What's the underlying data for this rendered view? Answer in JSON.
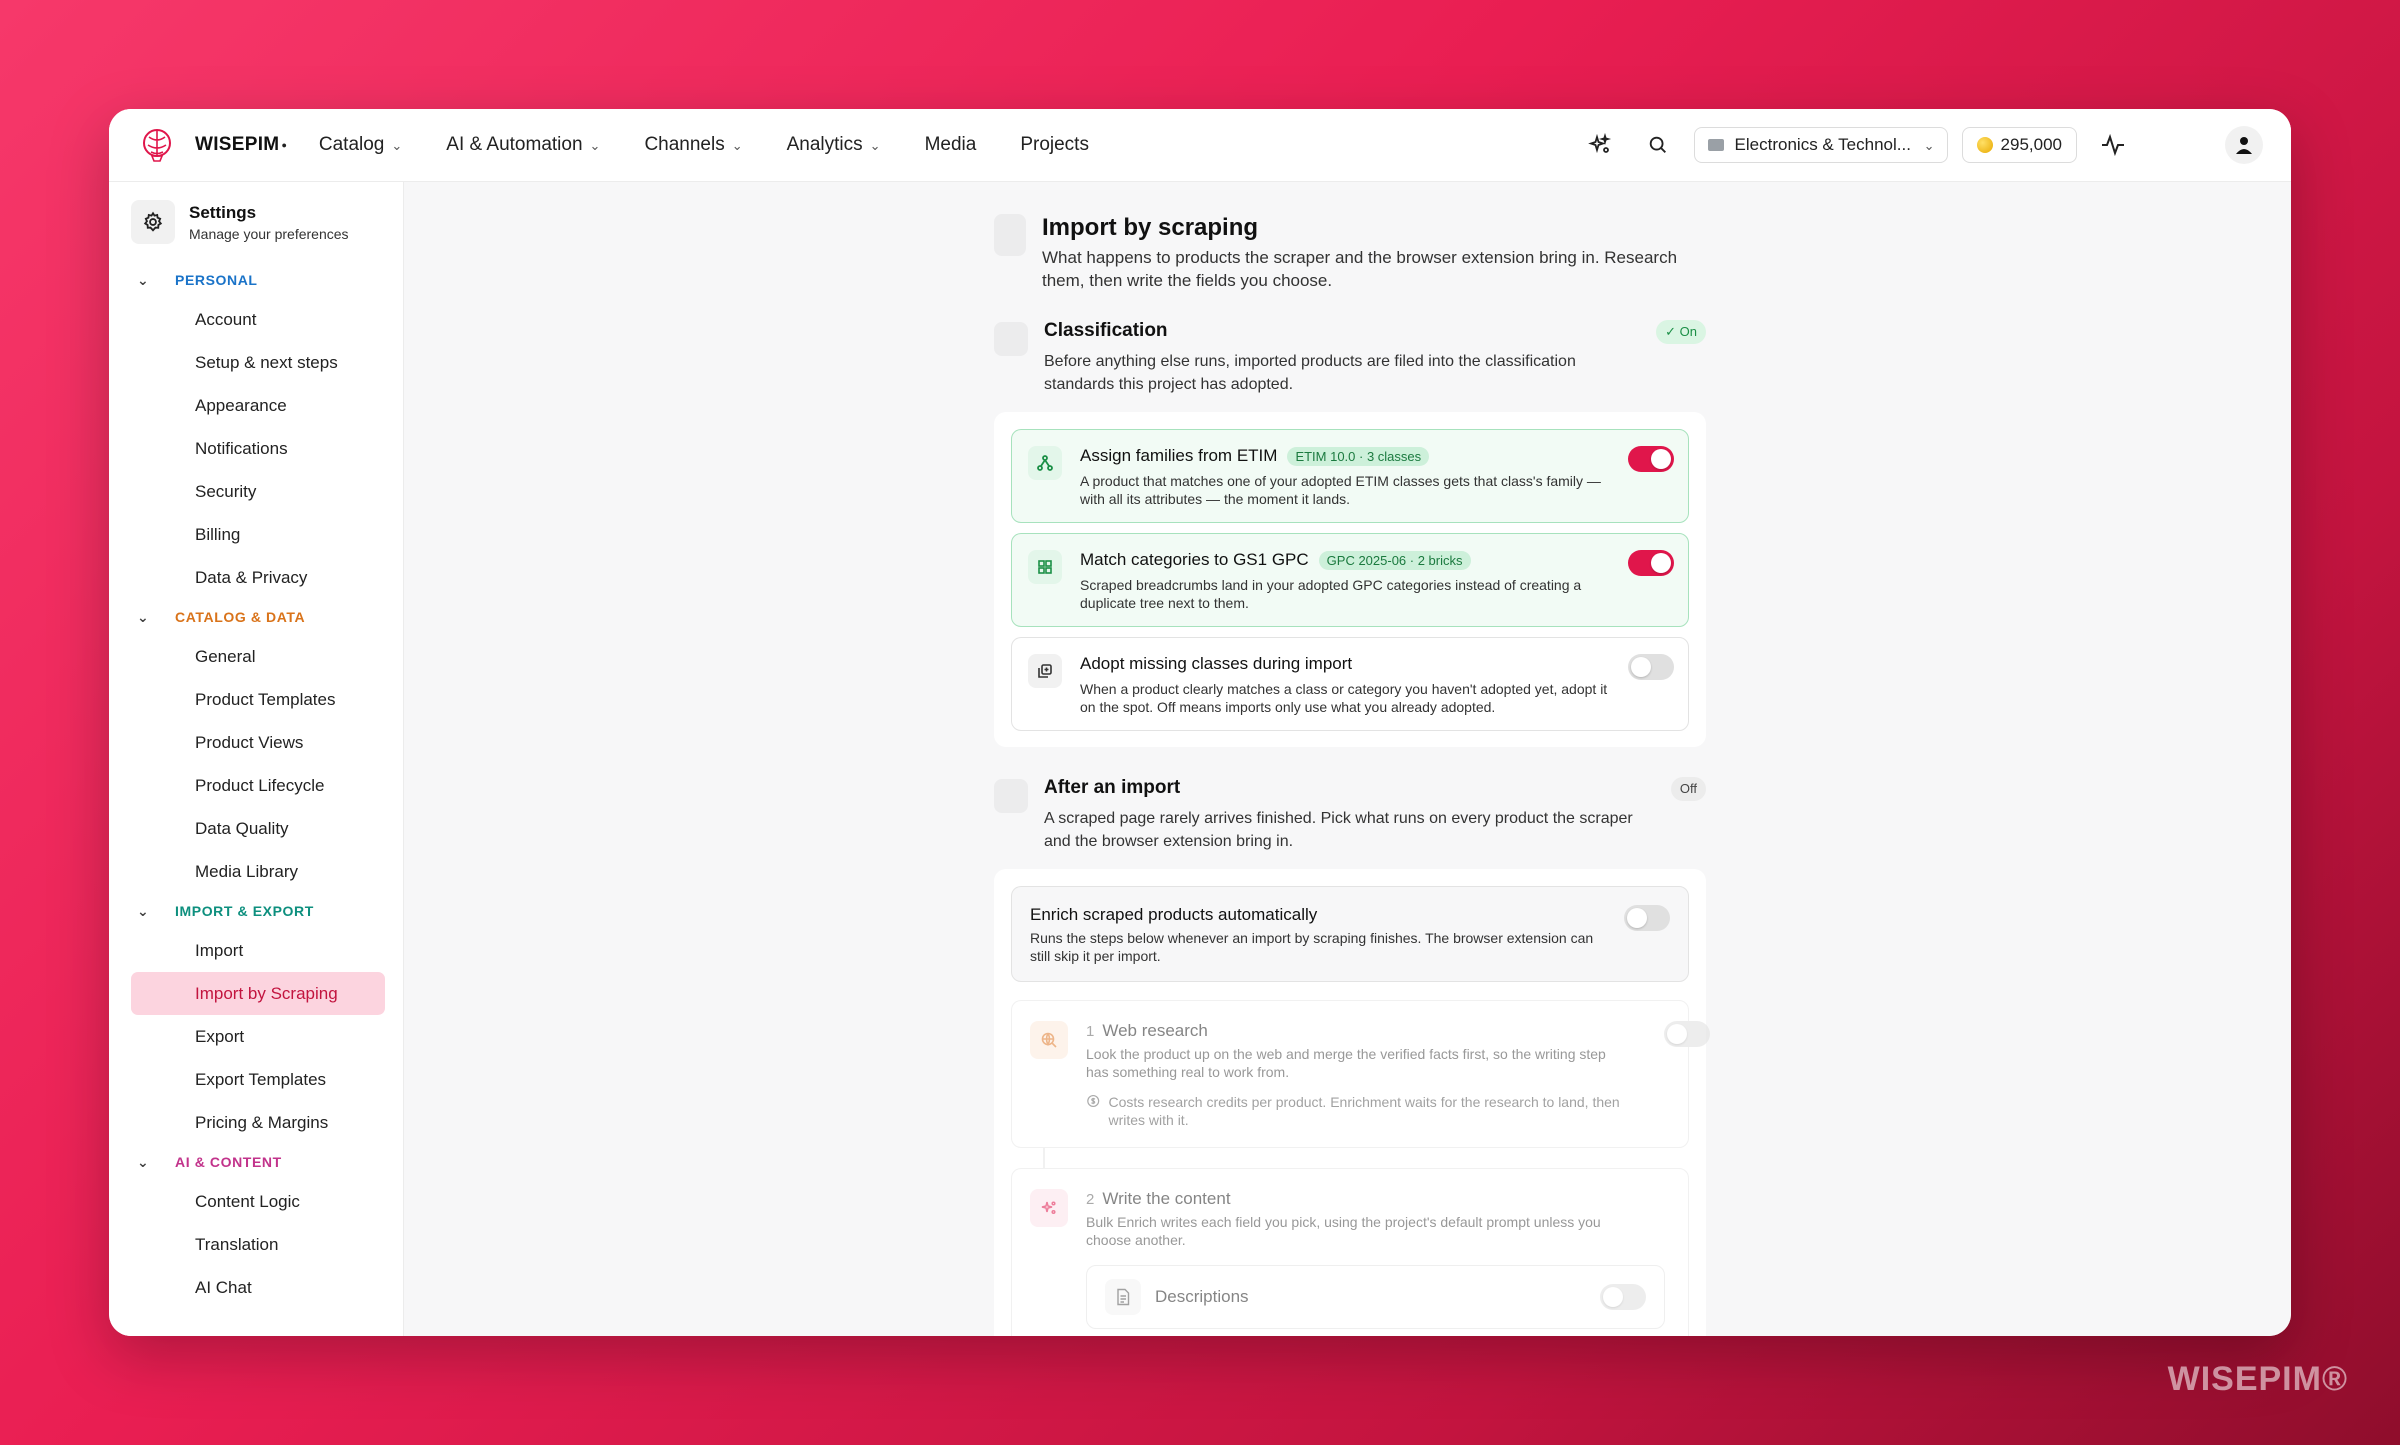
{
  "brand": "WISEPIM",
  "nav": [
    {
      "label": "Catalog",
      "dropdown": true
    },
    {
      "label": "AI & Automation",
      "dropdown": true
    },
    {
      "label": "Channels",
      "dropdown": true
    },
    {
      "label": "Analytics",
      "dropdown": true
    },
    {
      "label": "Media",
      "dropdown": false
    },
    {
      "label": "Projects",
      "dropdown": false
    }
  ],
  "topbar": {
    "project": "Electronics & Technol...",
    "credits": "295,000"
  },
  "sidebar": {
    "title": "Settings",
    "subtitle": "Manage your preferences",
    "groups": [
      {
        "label": "PERSONAL",
        "items": [
          "Account",
          "Setup & next steps",
          "Appearance",
          "Notifications",
          "Security",
          "Billing",
          "Data & Privacy"
        ]
      },
      {
        "label": "CATALOG & DATA",
        "items": [
          "General",
          "Product Templates",
          "Product Views",
          "Product Lifecycle",
          "Data Quality",
          "Media Library"
        ]
      },
      {
        "label": "IMPORT & EXPORT",
        "items": [
          "Import",
          "Import by Scraping",
          "Export",
          "Export Templates",
          "Pricing & Margins"
        ]
      },
      {
        "label": "AI & CONTENT",
        "items": [
          "Content Logic",
          "Translation",
          "AI Chat"
        ]
      }
    ],
    "active_item": "Import by Scraping"
  },
  "page": {
    "title": "Import by scraping",
    "description": "What happens to products the scraper and the browser extension bring in. Research them, then write the fields you choose."
  },
  "classification": {
    "title": "Classification",
    "status": "✓ On",
    "description": "Before anything else runs, imported products are filed into the classification standards this project has adopted.",
    "options": [
      {
        "title": "Assign families from ETIM",
        "tag": "ETIM 10.0 · 3 classes",
        "description": "A product that matches one of your adopted ETIM classes gets that class's family — with all its attributes — the moment it lands.",
        "enabled": true
      },
      {
        "title": "Match categories to GS1 GPC",
        "tag": "GPC 2025-06 · 2 bricks",
        "description": "Scraped breadcrumbs land in your adopted GPC categories instead of creating a duplicate tree next to them.",
        "enabled": true
      },
      {
        "title": "Adopt missing classes during import",
        "tag": "",
        "description": "When a product clearly matches a class or category you haven't adopted yet, adopt it on the spot. Off means imports only use what you already adopted.",
        "enabled": false
      }
    ]
  },
  "after_import": {
    "title": "After an import",
    "status": "Off",
    "description": "A scraped page rarely arrives finished. Pick what runs on every product the scraper and the browser extension bring in.",
    "enrich": {
      "title": "Enrich scraped products automatically",
      "description": "Runs the steps below whenever an import by scraping finishes. The browser extension can still skip it per import.",
      "enabled": false
    },
    "steps": [
      {
        "num": "1",
        "title": "Web research",
        "description": "Look the product up on the web and merge the verified facts first, so the writing step has something real to work from.",
        "note": "Costs research credits per product. Enrichment waits for the research to land, then writes with it."
      },
      {
        "num": "2",
        "title": "Write the content",
        "description": "Bulk Enrich writes each field you pick, using the project's default prompt unless you choose another.",
        "fields": [
          "Descriptions"
        ]
      }
    ]
  },
  "watermark": "WISEPIM®",
  "colors": {
    "accent": "#e0164b",
    "on_green": "#1b8f46"
  }
}
